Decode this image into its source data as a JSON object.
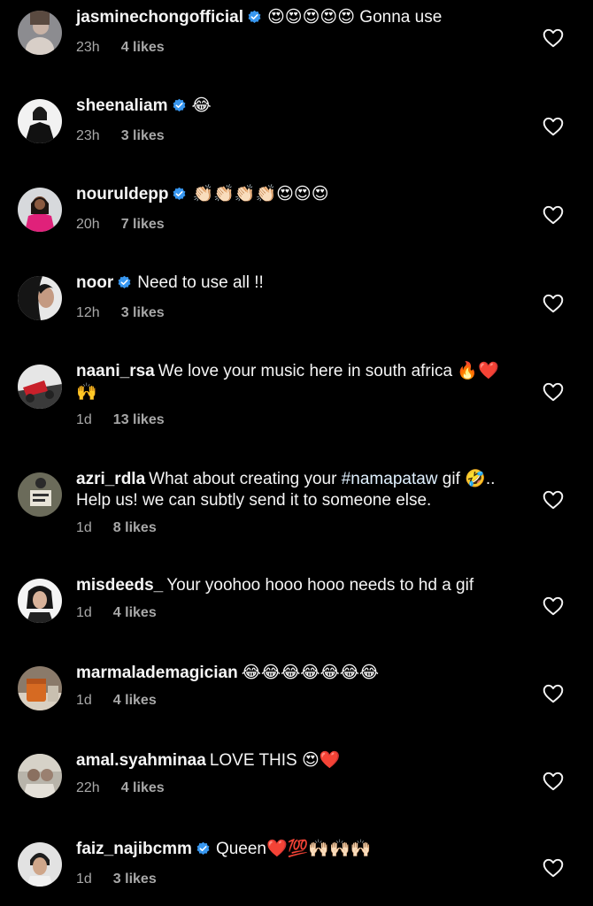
{
  "comments": [
    {
      "username": "jasminechongofficial",
      "verified": true,
      "message": "😍😍😍😍😍 Gonna use",
      "time": "23h",
      "likes": "4 likes"
    },
    {
      "username": "sheenaliam",
      "verified": true,
      "message": "😂",
      "time": "23h",
      "likes": "3 likes"
    },
    {
      "username": "nouruldepp",
      "verified": true,
      "message": "👏🏻👏🏻👏🏻👏🏻😍😍😍",
      "time": "20h",
      "likes": "7 likes"
    },
    {
      "username": "noor",
      "verified": true,
      "message": "Need to use all !!",
      "time": "12h",
      "likes": "3 likes"
    },
    {
      "username": "naani_rsa",
      "verified": false,
      "message": "We love your music here in south africa 🔥❤️🙌",
      "time": "1d",
      "likes": "13 likes"
    },
    {
      "username": "azri_rdla",
      "verified": false,
      "message_pre": "What about creating your ",
      "hashtag": "#namapataw",
      "message_post": " gif 🤣.. Help us! we can subtly send it to someone else.",
      "time": "1d",
      "likes": "8 likes"
    },
    {
      "username": "misdeeds_",
      "verified": false,
      "message": "Your yoohoo hooo hooo needs to hd a gif",
      "time": "1d",
      "likes": "4 likes"
    },
    {
      "username": "marmalademagician",
      "verified": false,
      "message": "😂😂😂😂😂😂😂",
      "time": "1d",
      "likes": "4 likes"
    },
    {
      "username": "amal.syahminaa",
      "verified": false,
      "message": "LOVE THIS 😍❤️",
      "time": "22h",
      "likes": "4 likes"
    },
    {
      "username": "faiz_najibcmm",
      "verified": true,
      "message": "Queen❤️💯🙌🏻🙌🏻🙌🏻",
      "time": "1d",
      "likes": "3 likes"
    }
  ],
  "icons": {
    "verified": "verified-badge-icon",
    "like": "heart-outline-icon"
  },
  "colors": {
    "background": "#000000",
    "text": "#f5f5f5",
    "meta": "#a8a8a8",
    "verified": "#3897f0"
  }
}
